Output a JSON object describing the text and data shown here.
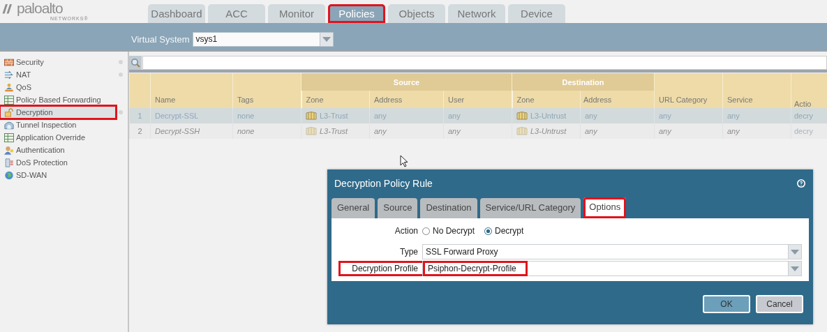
{
  "logo": {
    "text": "paloalto",
    "subtext": "NETWORKS®"
  },
  "tabs": [
    {
      "label": "Dashboard",
      "selected": false,
      "highlighted": false
    },
    {
      "label": "ACC",
      "selected": false,
      "highlighted": false
    },
    {
      "label": "Monitor",
      "selected": false,
      "highlighted": false
    },
    {
      "label": "Policies",
      "selected": true,
      "highlighted": true
    },
    {
      "label": "Objects",
      "selected": false,
      "highlighted": false
    },
    {
      "label": "Network",
      "selected": false,
      "highlighted": false
    },
    {
      "label": "Device",
      "selected": false,
      "highlighted": false
    }
  ],
  "virtual_system": {
    "label": "Virtual System",
    "value": "vsys1"
  },
  "sidebar": {
    "items": [
      {
        "label": "Security",
        "selected": false,
        "highlighted": false,
        "dot": true
      },
      {
        "label": "NAT",
        "selected": false,
        "highlighted": false,
        "dot": true
      },
      {
        "label": "QoS",
        "selected": false,
        "highlighted": false,
        "dot": false
      },
      {
        "label": "Policy Based Forwarding",
        "selected": false,
        "highlighted": false,
        "dot": false
      },
      {
        "label": "Decryption",
        "selected": true,
        "highlighted": true,
        "dot": true
      },
      {
        "label": "Tunnel Inspection",
        "selected": false,
        "highlighted": false,
        "dot": false
      },
      {
        "label": "Application Override",
        "selected": false,
        "highlighted": false,
        "dot": false
      },
      {
        "label": "Authentication",
        "selected": false,
        "highlighted": false,
        "dot": false
      },
      {
        "label": "DoS Protection",
        "selected": false,
        "highlighted": false,
        "dot": false
      },
      {
        "label": "SD-WAN",
        "selected": false,
        "highlighted": false,
        "dot": false
      }
    ]
  },
  "table": {
    "column_groups": [
      {
        "label": "Source"
      },
      {
        "label": "Destination"
      }
    ],
    "columns": [
      {
        "label": "Name",
        "grouped": false,
        "group_start": false
      },
      {
        "label": "Tags",
        "grouped": false,
        "group_start": false
      },
      {
        "label": "Zone",
        "kind": "zone",
        "grouped": true,
        "group_start": true
      },
      {
        "label": "Address",
        "grouped": true,
        "group_start": false
      },
      {
        "label": "User",
        "grouped": true,
        "group_start": false
      },
      {
        "label": "Zone",
        "kind": "zone",
        "grouped": true,
        "group_start": true
      },
      {
        "label": "Address",
        "grouped": true,
        "group_start": false
      },
      {
        "label": "URL Category",
        "grouped": false,
        "group_start": false
      },
      {
        "label": "Service",
        "grouped": false,
        "group_start": false
      },
      {
        "label": "Actio",
        "grouped": false,
        "group_start": false
      }
    ],
    "rows": [
      {
        "number": "1",
        "selected": true,
        "disabled": false,
        "cells": [
          "Decrypt-SSL",
          "none",
          "L3-Trust",
          "any",
          "any",
          "L3-Untrust",
          "any",
          "any",
          "any",
          "decry"
        ]
      },
      {
        "number": "2",
        "selected": false,
        "disabled": true,
        "cells": [
          "Decrypt-SSH",
          "none",
          "L3-Trust",
          "any",
          "any",
          "L3-Untrust",
          "any",
          "any",
          "any",
          "decry"
        ]
      }
    ]
  },
  "dialog": {
    "title": "Decryption Policy Rule",
    "tabs": [
      {
        "label": "General",
        "selected": false,
        "highlighted": false
      },
      {
        "label": "Source",
        "selected": false,
        "highlighted": false
      },
      {
        "label": "Destination",
        "selected": false,
        "highlighted": false
      },
      {
        "label": "Service/URL Category",
        "selected": false,
        "highlighted": false
      },
      {
        "label": "Options",
        "selected": true,
        "highlighted": true
      }
    ],
    "action": {
      "label": "Action",
      "options": [
        {
          "label": "No Decrypt",
          "selected": false
        },
        {
          "label": "Decrypt",
          "selected": true
        }
      ]
    },
    "fields": [
      {
        "label": "Type",
        "value": "SSL Forward Proxy",
        "highlighted": false
      },
      {
        "label": "Decryption Profile",
        "value": "Psiphon-Decrypt-Profile",
        "highlighted": true
      }
    ],
    "buttons": [
      {
        "label": "OK",
        "kind": "primary"
      },
      {
        "label": "Cancel",
        "kind": "secondary"
      }
    ]
  }
}
